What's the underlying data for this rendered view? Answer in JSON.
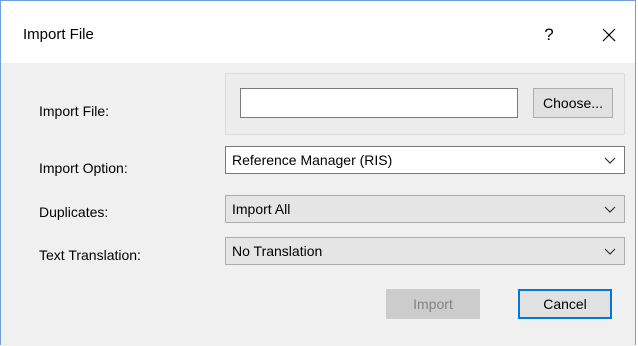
{
  "dialog": {
    "title": "Import File",
    "help_label": "?",
    "close_icon": "close-icon"
  },
  "form": {
    "import_file_label": "Import File:",
    "import_file_value": "",
    "choose_label": "Choose...",
    "import_option_label": "Import Option:",
    "import_option_value": "Reference Manager (RIS)",
    "duplicates_label": "Duplicates:",
    "duplicates_value": "Import All",
    "text_translation_label": "Text Translation:",
    "text_translation_value": "No Translation"
  },
  "buttons": {
    "import_label": "Import",
    "cancel_label": "Cancel"
  },
  "colors": {
    "accent": "#0078d7",
    "dialog_background": "#f0f0f0",
    "disabled_button": "#cccccc",
    "disabled_text": "#838383"
  }
}
